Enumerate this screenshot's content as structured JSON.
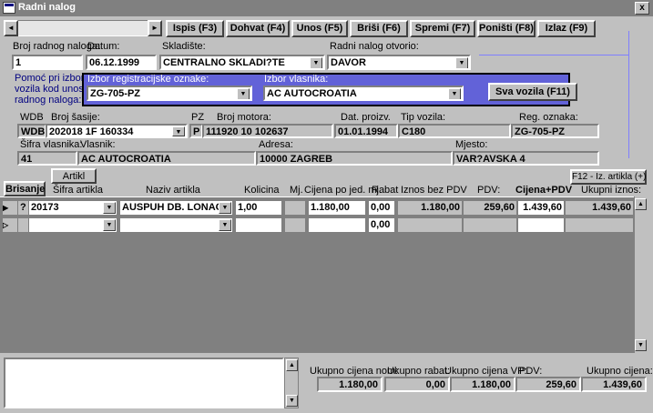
{
  "window": {
    "title": "Radni nalog",
    "close": "x"
  },
  "toolbar": {
    "nav_left": "◄",
    "nav_right": "►",
    "buttons": [
      "Ispis (F3)",
      "Dohvat (F4)",
      "Unos (F5)",
      "Briši (F6)",
      "Spremi (F7)",
      "Poništi (F8)",
      "Izlaz (F9)"
    ]
  },
  "header": {
    "broj_label": "Broj radnog naloga:",
    "broj_value": "1",
    "datum_label": "Datum:",
    "datum_value": "06.12.1999",
    "skladiste_label": "Skladište:",
    "skladiste_value": "CENTRALNO SKLADI?TE",
    "otvorio_label": "Radni nalog otvorio:",
    "otvorio_value": "DAVOR"
  },
  "helper": {
    "hint": [
      "Pomoć pri izboru",
      "vozila kod unosa",
      "radnog naloga:"
    ],
    "reg_label": "Izbor registracijske oznake:",
    "reg_value": "ZG-705-PZ",
    "vlasnik_label": "Izbor vlasnika:",
    "vlasnik_value": "AC AUTOCROATIA",
    "sva_vozila": "Sva vozila (F11)"
  },
  "vehicle": {
    "wdb_label": "WDB",
    "wdb_value": "WDB",
    "sasija_label": "Broj šasije:",
    "sasija_value": "202018 1F 160334",
    "pz_label": "PZ",
    "pz_value": "P",
    "motor_label": "Broj motora:",
    "motor_value": "111920 10 102637",
    "dat_label": "Dat. proizv.",
    "dat_value": "01.01.1994",
    "tip_label": "Tip vozila:",
    "tip_value": "C180",
    "reg_label": "Reg. oznaka:",
    "reg_value": "ZG-705-PZ"
  },
  "owner": {
    "sifra_label": "Šifra vlasnika:",
    "sifra_value": "41",
    "vlasnik_label": "Vlasnik:",
    "vlasnik_value": "AC AUTOCROATIA",
    "adresa_label": "Adresa:",
    "adresa_value": "10000 ZAGREB",
    "mjesto_label": "Mjesto:",
    "mjesto_value": "VAR?AVSKA 4"
  },
  "table": {
    "brisanje": "Brisanje",
    "artikl": "Artikl",
    "f12": "F12 - Iz. artikla (+)",
    "headers": {
      "sifra": "Šifra artikla",
      "naziv": "Naziv artikla",
      "kolicina": "Kolicina",
      "mj": "Mj.",
      "cijena": "Cijena po jed. mj.",
      "rabat": "Rabat",
      "iznos": "Iznos bez PDV",
      "pdv": "PDV:",
      "cijena_pdv": "Cijena+PDV",
      "ukupni": "Ukupni iznos:"
    },
    "row1": {
      "q": "?",
      "sifra": "20173",
      "naziv": "AUSPUH DB. LONAC",
      "kolicina": "1,00",
      "mj": "",
      "cijena": "1.180,00",
      "rabat": "0,00",
      "iznos": "1.180,00",
      "pdv": "259,60",
      "cijena_pdv": "1.439,60",
      "ukupni": "1.439,60"
    },
    "row2": {
      "rabat": "0,00"
    }
  },
  "totals": {
    "nom_label": "Ukupno cijena nom:",
    "nom_value": "1.180,00",
    "rabat_label": "Ukupno rabat:",
    "rabat_value": "0,00",
    "vp_label": "Ukupno cijena VP:",
    "vp_value": "1.180,00",
    "pdv_label": "PDV:",
    "pdv_value": "259,60",
    "cijena_label": "Ukupno cijena:",
    "cijena_value": "1.439,60"
  }
}
